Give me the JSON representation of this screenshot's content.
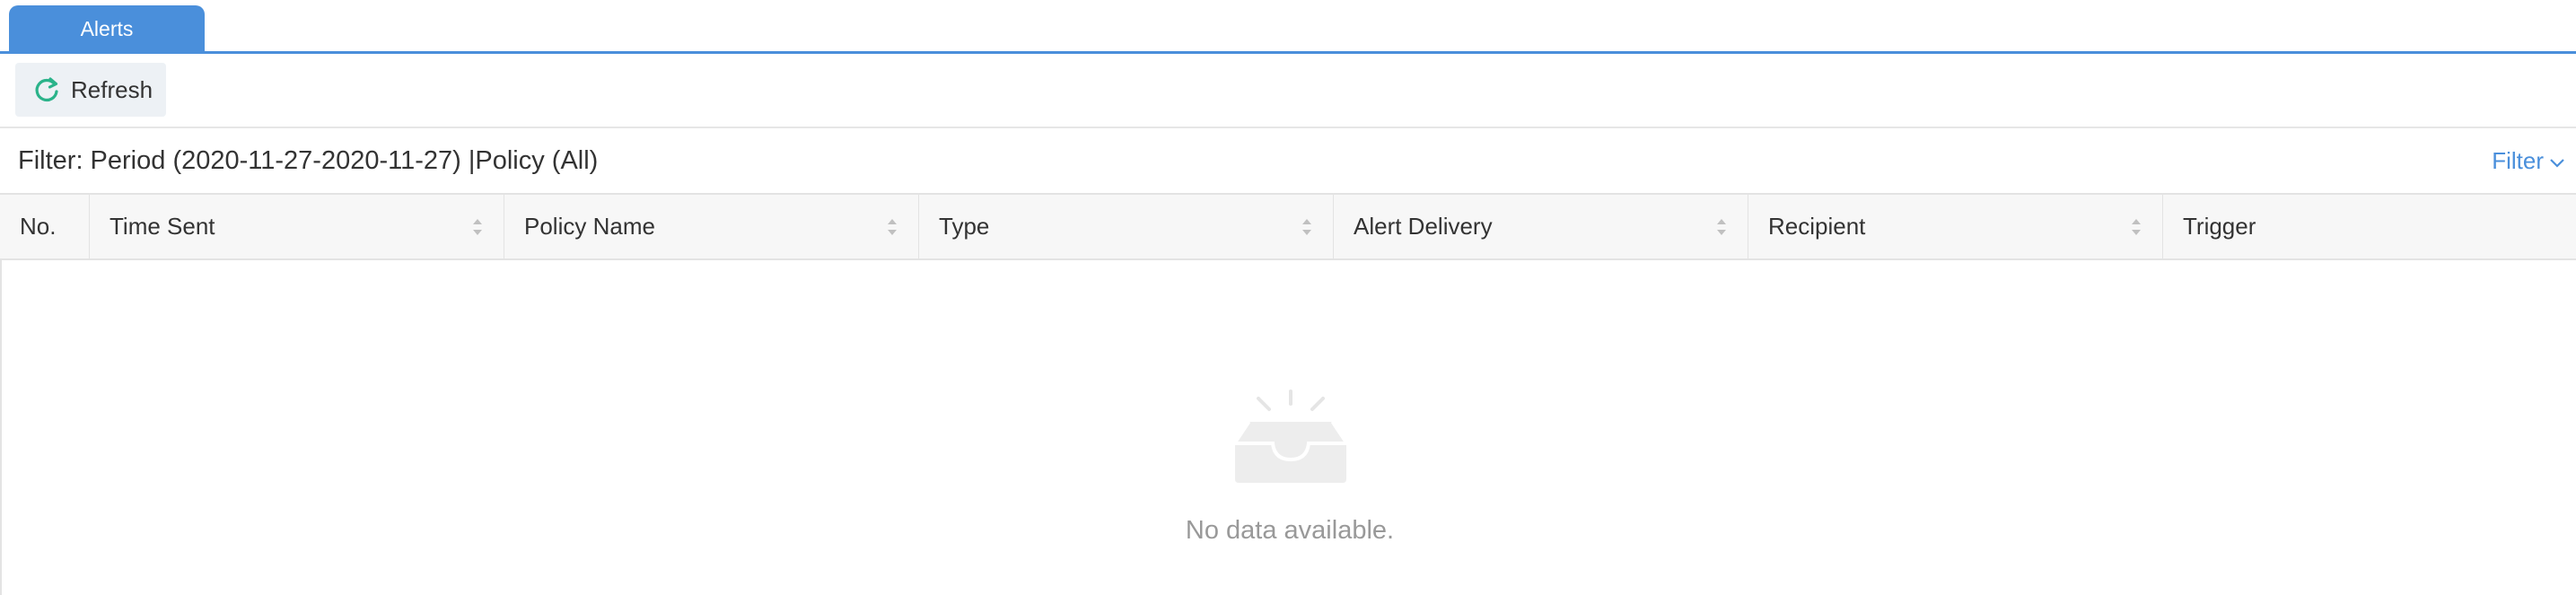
{
  "tabs": [
    {
      "label": "Alerts",
      "active": true
    }
  ],
  "toolbar": {
    "refresh_label": "Refresh",
    "refresh_icon": "refresh-icon",
    "refresh_icon_color": "#2bb38a"
  },
  "filter": {
    "summary": "Filter: Period (2020-11-27-2020-11-27) |Policy (All)",
    "link_label": "Filter",
    "link_icon": "chevron-down-icon"
  },
  "table": {
    "columns": [
      "No.",
      "Time Sent",
      "Policy Name",
      "Type",
      "Alert Delivery",
      "Recipient",
      "Trigger"
    ],
    "rows": [],
    "empty_message": "No data available."
  },
  "colors": {
    "accent": "#4a8fdb",
    "header_bg": "#f7f7f7",
    "muted_text": "#999999"
  }
}
